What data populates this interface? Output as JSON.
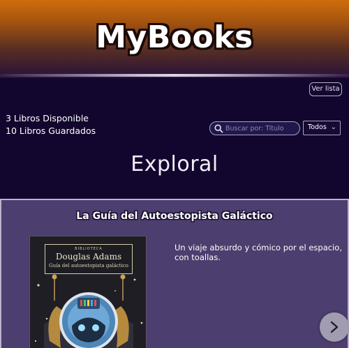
{
  "app": {
    "logo": "MyBooks",
    "ver_lista_label": "Ver lista"
  },
  "stats": {
    "available": "3 Libros Disponible",
    "saved": "10 Libros Guardados"
  },
  "search": {
    "placeholder": "Buscar por: Titulo",
    "value": ""
  },
  "filter": {
    "selected": "Todos",
    "chevron": "⌄"
  },
  "section": {
    "title": "Exploral"
  },
  "book": {
    "title": "La Guía del Autoestopista Galáctico",
    "description": "Un viaje absurdo y cómico por el espacio, con toallas.",
    "cover": {
      "series": "BIBLIOTECA",
      "author": "Douglas Adams",
      "subtitle": "Guía del autoestopista galáctico"
    }
  },
  "icons": {
    "search": "search-icon",
    "next": "chevron-right-icon"
  },
  "colors": {
    "header_top": "#cf6d0c",
    "background": "#13062e",
    "card": "#4c3e6e"
  }
}
